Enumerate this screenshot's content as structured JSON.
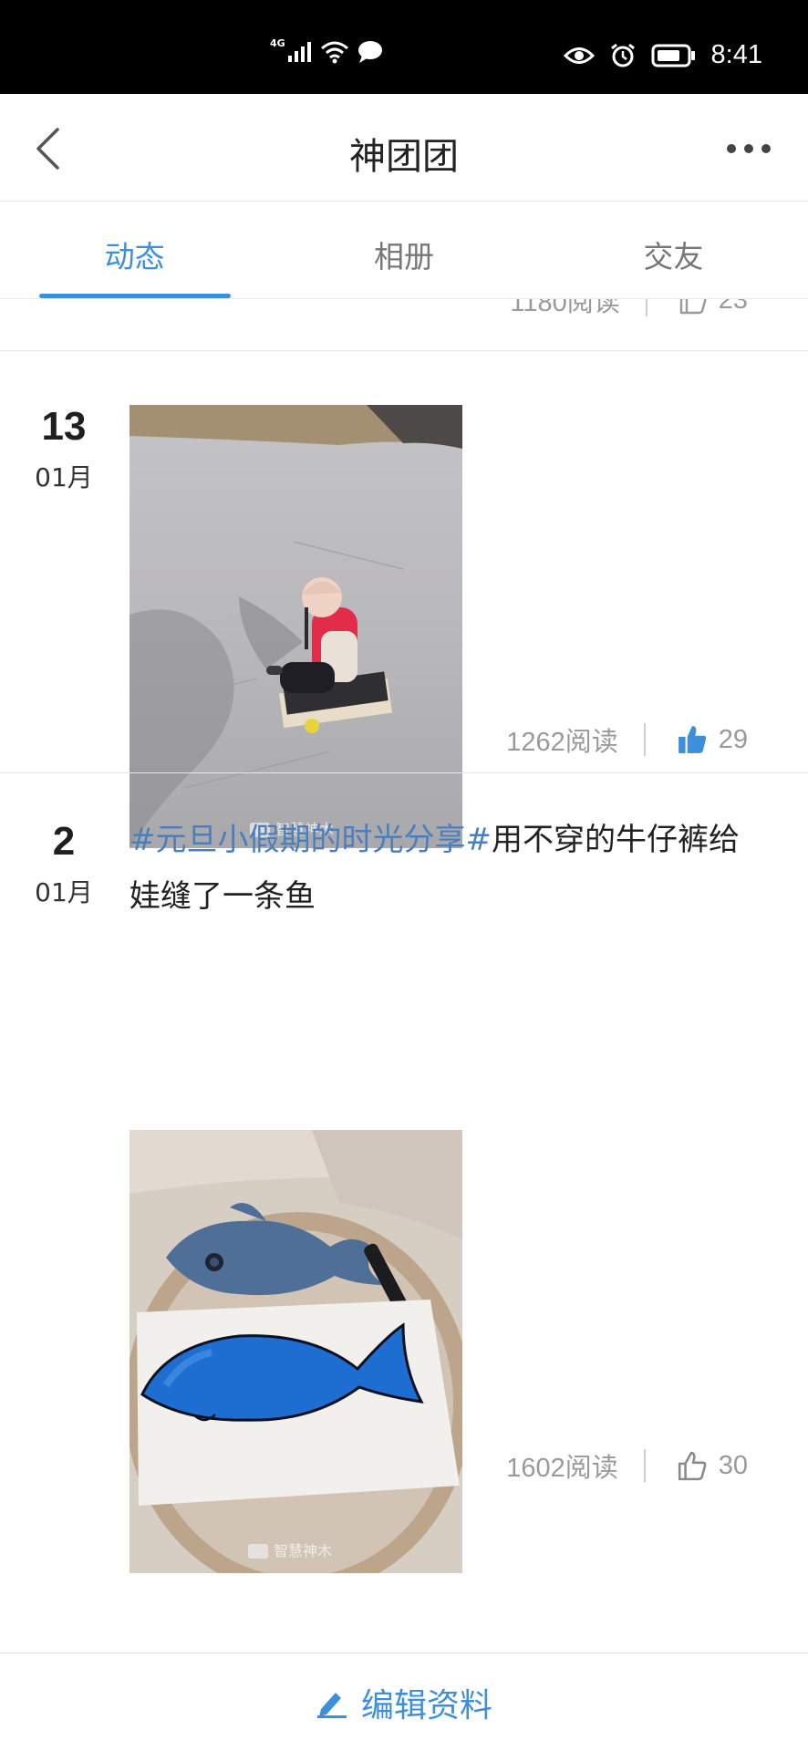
{
  "status_bar": {
    "network": "4G",
    "time": "8:41",
    "icons": [
      "signal-icon",
      "wifi-icon",
      "chat-bubble-icon",
      "eye-icon",
      "alarm-icon",
      "battery-icon"
    ]
  },
  "header": {
    "title": "神团团",
    "back_icon": "chevron-left-icon",
    "more_icon": "more-dots-icon"
  },
  "tabs": [
    {
      "label": "动态",
      "active": true
    },
    {
      "label": "相册",
      "active": false
    },
    {
      "label": "交友",
      "active": false
    }
  ],
  "feed": {
    "partial_item": {
      "reads": "1180阅读",
      "likes": "23"
    },
    "posts": [
      {
        "day": "13",
        "month": "01月",
        "text_hashtag": "",
        "text_body": "",
        "image": "child-sledding-on-ice-photo",
        "reads": "1262阅读",
        "likes": "29",
        "liked": true
      },
      {
        "day": "2",
        "month": "01月",
        "text_hashtag": "#元旦小假期的时光分享#",
        "text_body": "用不穿的牛仔裤给娃缝了一条鱼",
        "image": "denim-fish-and-drawing-photo",
        "reads": "1602阅读",
        "likes": "30",
        "liked": false
      }
    ],
    "watermark": "智慧神木"
  },
  "bottom_bar": {
    "edit_label": "编辑资料",
    "edit_icon": "pencil-icon"
  },
  "colors": {
    "accent": "#3d8fdc",
    "hashtag": "#4a7fbf",
    "muted_text": "#9a9a9a"
  }
}
